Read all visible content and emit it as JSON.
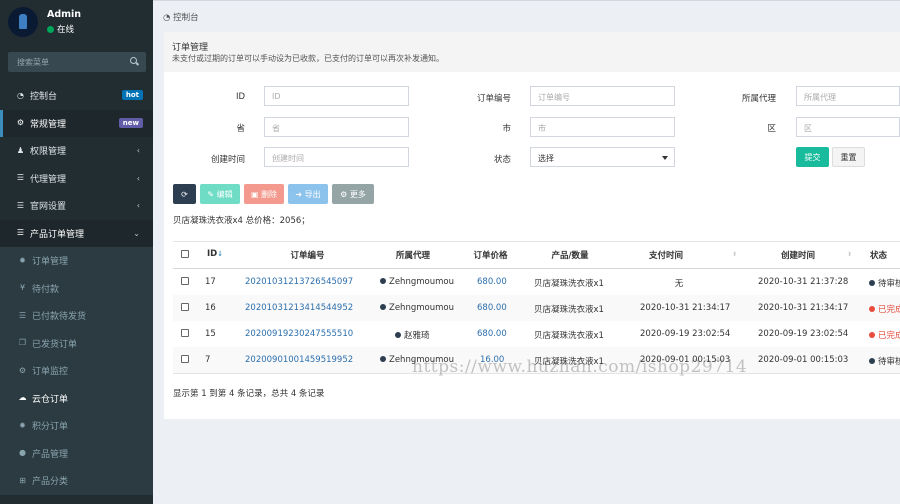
{
  "user": {
    "name": "Admin",
    "status": "在线"
  },
  "search": {
    "placeholder": "搜索菜单"
  },
  "menu": [
    {
      "label": "控制台",
      "badge": "hot",
      "icon": "dashboard-icon"
    },
    {
      "label": "常规管理",
      "badge": "new",
      "icon": "cogs-icon"
    },
    {
      "label": "权限管理",
      "icon": "group-icon"
    },
    {
      "label": "代理管理",
      "icon": "list-icon"
    },
    {
      "label": "官网设置",
      "icon": "list-icon"
    },
    {
      "label": "产品订单管理",
      "icon": "list-icon"
    },
    {
      "label": "订单管理",
      "icon": "gear-icon"
    },
    {
      "label": "待付款",
      "icon": "yen-icon"
    },
    {
      "label": "已付款待发货",
      "icon": "list-icon"
    },
    {
      "label": "已发货订单",
      "icon": "copy-icon"
    },
    {
      "label": "订单监控",
      "icon": "cogs-icon"
    },
    {
      "label": "云仓订单",
      "icon": "cloud-icon"
    },
    {
      "label": "积分订单",
      "icon": "gear-icon"
    },
    {
      "label": "产品管理",
      "icon": "product-icon"
    },
    {
      "label": "产品分类",
      "icon": "sitemap-icon"
    }
  ],
  "breadcrumb": "控制台",
  "panel": {
    "title": "订单管理",
    "desc": "未支付或过期的订单可以手动设为已收款，已支付的订单可以再次补发通知。"
  },
  "filters": {
    "id_label": "ID",
    "id_ph": "ID",
    "order_no_label": "订单编号",
    "order_no_ph": "订单编号",
    "agent_label": "所属代理",
    "agent_ph": "所属代理",
    "province_label": "省",
    "province_ph": "省",
    "city_label": "市",
    "city_ph": "市",
    "district_label": "区",
    "district_ph": "区",
    "created_label": "创建时间",
    "created_ph": "创建时间",
    "status_label": "状态",
    "status_value": "选择",
    "submit": "提交",
    "reset": "重置"
  },
  "toolbar": {
    "edit": "编辑",
    "delete": "删除",
    "export": "导出",
    "more": "更多"
  },
  "summary": "贝店凝珠洗衣液x4 总价格：2056；",
  "columns": [
    "ID",
    "订单编号",
    "所属代理",
    "订单价格",
    "产品/数量",
    "支付时间",
    "创建时间",
    "状态"
  ],
  "rows": [
    {
      "id": "17",
      "order_no": "20201031213726545097",
      "agent": "Zehngmoumou",
      "price": "680.00",
      "product": "贝店凝珠洗衣液x1",
      "pay_time": "无",
      "created": "2020-10-31 21:37:28",
      "status": "待审核",
      "status_color": "dark"
    },
    {
      "id": "16",
      "order_no": "20201031213414544952",
      "agent": "Zehngmoumou",
      "price": "680.00",
      "product": "贝店凝珠洗衣液x1",
      "pay_time": "2020-10-31 21:34:17",
      "created": "2020-10-31 21:34:17",
      "status": "已完成",
      "status_color": "red"
    },
    {
      "id": "15",
      "order_no": "20200919230247555510",
      "agent": "赵雅琦",
      "price": "680.00",
      "product": "贝店凝珠洗衣液x1",
      "pay_time": "2020-09-19 23:02:54",
      "created": "2020-09-19 23:02:54",
      "status": "已完成",
      "status_color": "red"
    },
    {
      "id": "7",
      "order_no": "20200901001459519952",
      "agent": "Zehngmoumou",
      "price": "16.00",
      "product": "贝店凝珠洗衣液x1",
      "pay_time": "2020-09-01 00:15:03",
      "created": "2020-09-01 00:15:03",
      "status": "待审核",
      "status_color": "dark"
    }
  ],
  "footer": "显示第 1 到第 4 条记录，总共 4 条记录",
  "watermark": "https://www.huzhan.com/ishop29714",
  "colors": {
    "sidebar": "#222d32",
    "accent": "#3c8dbc",
    "success": "#18bc9c",
    "danger": "#e74c3c"
  }
}
